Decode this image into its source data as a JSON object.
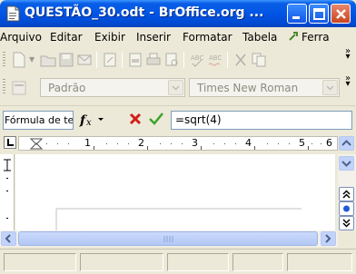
{
  "window": {
    "title": "QUESTÃO_30.odt - BrOffice.org ..."
  },
  "menubar": {
    "items": [
      {
        "label": "Arquivo"
      },
      {
        "label": "Editar"
      },
      {
        "label": "Exibir"
      },
      {
        "label": "Inserir"
      },
      {
        "label": "Formatar"
      },
      {
        "label": "Tabela"
      },
      {
        "label": "Ferra"
      }
    ]
  },
  "formatting": {
    "style_value": "Padrão",
    "font_value": "Times New Roman"
  },
  "formula_bar": {
    "name_box": "Fórmula de texto",
    "formula": "=sqrt(4)"
  },
  "ruler": {
    "numbers": [
      "1",
      "2",
      "3",
      "4",
      "5",
      "6"
    ]
  },
  "colors": {
    "titlebar": "#0055e5",
    "chrome": "#ece9d8",
    "cancel_red": "#d0201a",
    "accept_green": "#3ca52a"
  }
}
